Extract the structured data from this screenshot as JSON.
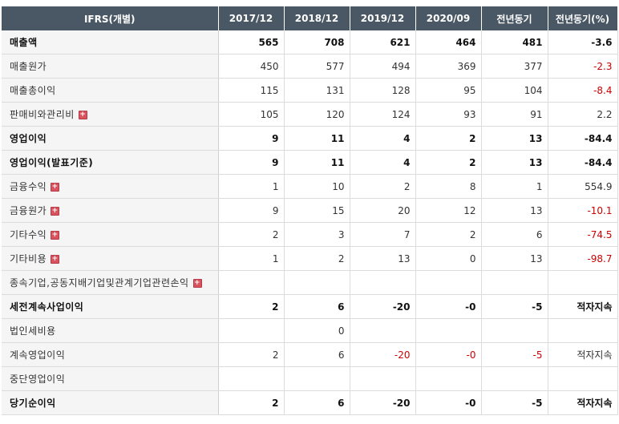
{
  "header": {
    "label": "IFRS(개별)",
    "periods": [
      "2017/12",
      "2018/12",
      "2019/12",
      "2020/09",
      "전년동기",
      "전년동기(%)"
    ]
  },
  "rows": [
    {
      "label": "매출액",
      "bold": true,
      "expandable": false,
      "values": [
        "565",
        "708",
        "621",
        "464",
        "481",
        "-3.6"
      ]
    },
    {
      "label": "매출원가",
      "bold": false,
      "expandable": false,
      "values": [
        "450",
        "577",
        "494",
        "369",
        "377",
        "-2.3"
      ]
    },
    {
      "label": "매출총이익",
      "bold": false,
      "expandable": false,
      "values": [
        "115",
        "131",
        "128",
        "95",
        "104",
        "-8.4"
      ]
    },
    {
      "label": "판매비와관리비",
      "bold": false,
      "expandable": true,
      "values": [
        "105",
        "120",
        "124",
        "93",
        "91",
        "2.2"
      ]
    },
    {
      "label": "영업이익",
      "bold": true,
      "expandable": false,
      "values": [
        "9",
        "11",
        "4",
        "2",
        "13",
        "-84.4"
      ]
    },
    {
      "label": "영업이익(발표기준)",
      "bold": true,
      "expandable": false,
      "values": [
        "9",
        "11",
        "4",
        "2",
        "13",
        "-84.4"
      ]
    },
    {
      "label": "금융수익",
      "bold": false,
      "expandable": true,
      "values": [
        "1",
        "10",
        "2",
        "8",
        "1",
        "554.9"
      ]
    },
    {
      "label": "금융원가",
      "bold": false,
      "expandable": true,
      "values": [
        "9",
        "15",
        "20",
        "12",
        "13",
        "-10.1"
      ]
    },
    {
      "label": "기타수익",
      "bold": false,
      "expandable": true,
      "values": [
        "2",
        "3",
        "7",
        "2",
        "6",
        "-74.5"
      ]
    },
    {
      "label": "기타비용",
      "bold": false,
      "expandable": true,
      "values": [
        "1",
        "2",
        "13",
        "0",
        "13",
        "-98.7"
      ]
    },
    {
      "label": "종속기업,공동지배기업및관계기업관련손익",
      "bold": false,
      "expandable": true,
      "values": [
        "",
        "",
        "",
        "",
        "",
        ""
      ]
    },
    {
      "label": "세전계속사업이익",
      "bold": true,
      "expandable": false,
      "values": [
        "2",
        "6",
        "-20",
        "-0",
        "-5",
        "적자지속"
      ]
    },
    {
      "label": "법인세비용",
      "bold": false,
      "expandable": false,
      "values": [
        "",
        "0",
        "",
        "",
        "",
        ""
      ]
    },
    {
      "label": "계속영업이익",
      "bold": false,
      "expandable": false,
      "values": [
        "2",
        "6",
        "-20",
        "-0",
        "-5",
        "적자지속"
      ]
    },
    {
      "label": "중단영업이익",
      "bold": false,
      "expandable": false,
      "values": [
        "",
        "",
        "",
        "",
        "",
        ""
      ]
    },
    {
      "label": "당기순이익",
      "bold": true,
      "expandable": false,
      "values": [
        "2",
        "6",
        "-20",
        "-0",
        "-5",
        "적자지속"
      ]
    }
  ],
  "icons": {
    "expand": "plus-icon"
  },
  "colors": {
    "header_bg": "#4a5764",
    "negative": "#cc0000",
    "label_bg": "#f5f5f5"
  }
}
